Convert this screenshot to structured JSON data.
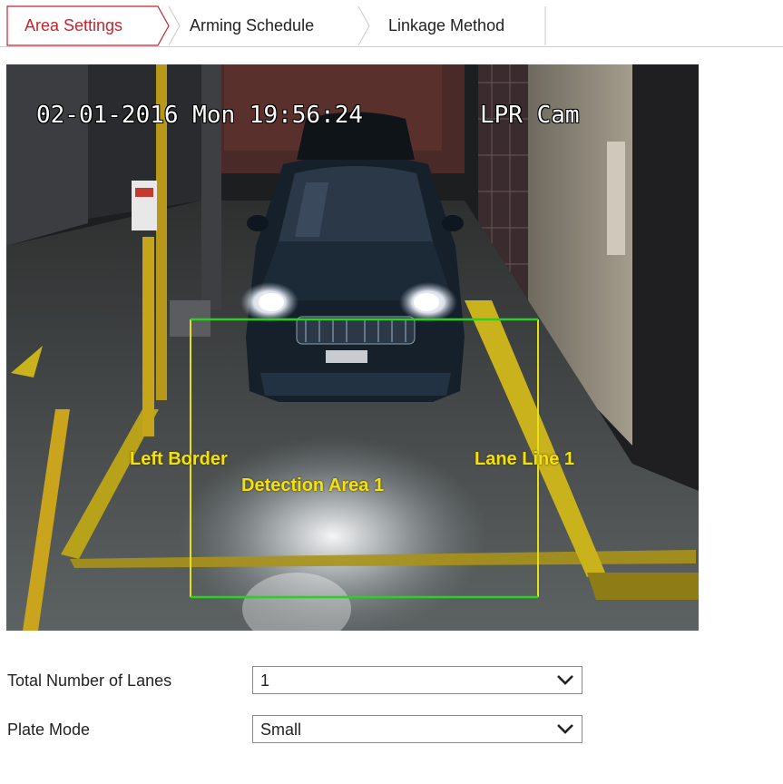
{
  "tabs": [
    {
      "label": "Area Settings",
      "active": true
    },
    {
      "label": "Arming Schedule",
      "active": false
    },
    {
      "label": "Linkage Method",
      "active": false
    }
  ],
  "colors": {
    "active_tab": "#c8232c",
    "detection_box": "#28d21e",
    "lane_lines": "#e8e012",
    "overlay_text": "#f4e10a"
  },
  "video": {
    "osd_datetime": "02-01-2016 Mon 19:56:24",
    "osd_camera": "LPR Cam",
    "labels": {
      "left_border": "Left Border",
      "detection_area": "Detection Area 1",
      "lane_line": "Lane Line 1"
    }
  },
  "form": {
    "lanes": {
      "label": "Total Number of Lanes",
      "value": "1",
      "icon": "chevron-down-icon"
    },
    "plate_mode": {
      "label": "Plate Mode",
      "value": "Small",
      "icon": "chevron-down-icon"
    }
  }
}
